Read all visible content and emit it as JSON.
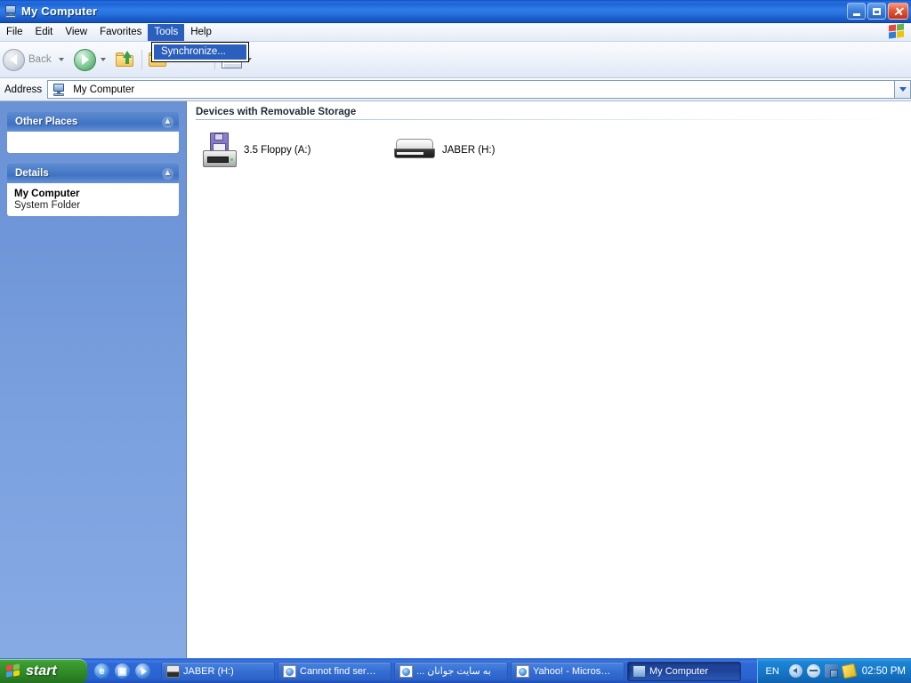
{
  "window": {
    "title": "My Computer",
    "icon": "my-computer-icon",
    "buttons": {
      "minimize": "_",
      "maximize": "❐",
      "close": "✕"
    }
  },
  "menubar": {
    "items": [
      {
        "label": "File",
        "active": false
      },
      {
        "label": "Edit",
        "active": false
      },
      {
        "label": "View",
        "active": false
      },
      {
        "label": "Favorites",
        "active": false
      },
      {
        "label": "Tools",
        "active": true
      },
      {
        "label": "Help",
        "active": false
      }
    ],
    "branding_icon": "windows-flag-icon"
  },
  "dropdown": {
    "open_menu": "Tools",
    "items": [
      {
        "label": "Synchronize...",
        "selected": true
      }
    ]
  },
  "toolbar": {
    "back_label": "Back",
    "forward_label": "",
    "up_label": "",
    "folders_label": "Folders",
    "views_label": ""
  },
  "address": {
    "label": "Address",
    "value": "My Computer",
    "icon": "my-computer-icon",
    "dropdown_icon": "chevron-down-icon"
  },
  "sidebar": {
    "panels": [
      {
        "title": "Other Places",
        "collapse_icon": "chevron-up-icon",
        "items": []
      },
      {
        "title": "Details",
        "collapse_icon": "chevron-up-icon",
        "detail_title": "My Computer",
        "detail_subtitle": "System Folder"
      }
    ]
  },
  "main": {
    "group_title": "Devices with Removable Storage",
    "items": [
      {
        "label": "3.5 Floppy (A:)",
        "icon": "floppy-drive-icon"
      },
      {
        "label": "JABER (H:)",
        "icon": "removable-disk-icon"
      }
    ]
  },
  "taskbar": {
    "start_label": "start",
    "quicklaunch": [
      {
        "name": "internet-explorer-icon"
      },
      {
        "name": "show-desktop-icon"
      },
      {
        "name": "windows-media-player-icon"
      }
    ],
    "tasks": [
      {
        "label": "JABER (H:)",
        "icon": "removable-disk-icon",
        "active": false,
        "rtl": false
      },
      {
        "label": "Cannot find ser…",
        "icon": "ie-document-icon",
        "active": false,
        "rtl": false
      },
      {
        "label": "به سایت جوانان ...",
        "icon": "ie-document-icon",
        "active": false,
        "rtl": true
      },
      {
        "label": "Yahoo! - Micros…",
        "icon": "ie-document-icon",
        "active": false,
        "rtl": false
      },
      {
        "label": "My Computer",
        "icon": "my-computer-icon",
        "active": true,
        "rtl": false
      }
    ],
    "language": "EN",
    "tray_icons": [
      {
        "name": "hide-tray-arrow-icon"
      },
      {
        "name": "tray-status-icon"
      },
      {
        "name": "network-connection-icon"
      },
      {
        "name": "pencil-note-icon"
      }
    ],
    "clock": "02:50 PM"
  },
  "colors": {
    "titlebar_blue": "#2f7ce8",
    "accent_blue": "#2a5fbd",
    "sidebar_blue": "#7aa0de",
    "start_green": "#3f9e33",
    "tray_blue": "#1676c6"
  }
}
